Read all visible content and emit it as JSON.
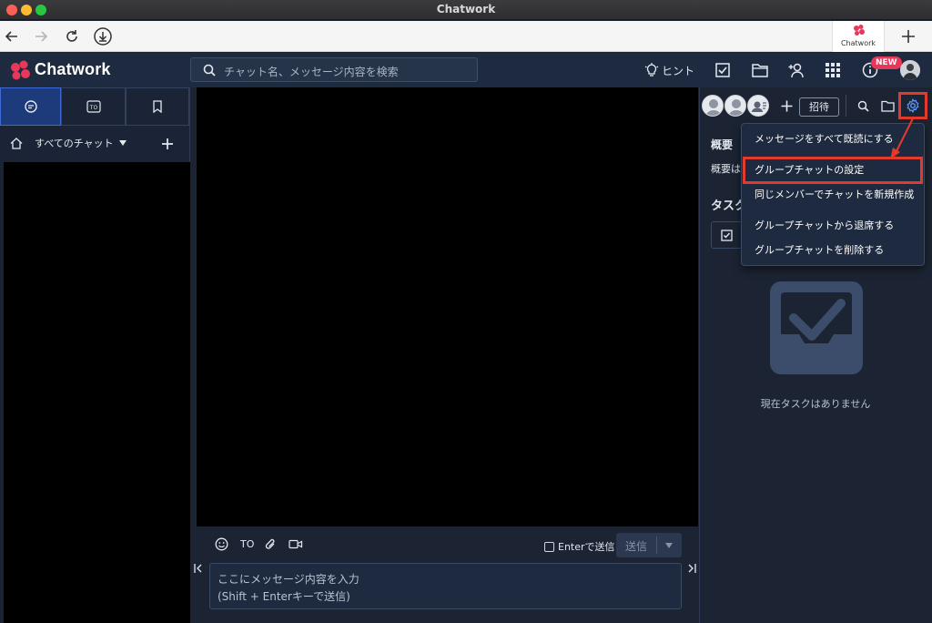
{
  "window": {
    "title": "Chatwork"
  },
  "browser": {
    "tab_label": "Chatwork"
  },
  "header": {
    "brand": "Chatwork",
    "search_placeholder": "チャット名、メッセージ内容を検索",
    "hint_label": "ヒント",
    "new_badge": "NEW"
  },
  "sidebar": {
    "filter_label": "すべてのチャット"
  },
  "composer": {
    "tool_to": "TO",
    "enter_send_label": "Enterで送信",
    "send_label": "送信",
    "placeholder_line1": "ここにメッセージ内容を入力",
    "placeholder_line2": "(Shift + Enterキーで送信)"
  },
  "room": {
    "invite_label": "招待",
    "overview_title": "概要",
    "overview_text": "概要は",
    "task_title": "タスク",
    "no_task_text": "現在タスクはありません"
  },
  "settings_menu": {
    "items": [
      "メッセージをすべて既読にする",
      "グループチャットの設定",
      "同じメンバーでチャットを新規作成",
      "グループチャットから退席する",
      "グループチャットを削除する"
    ],
    "highlighted_index": 1
  },
  "colors": {
    "header_bg": "#1e2a3f",
    "accent_red": "#e23b2e",
    "new_badge": "#e8385a",
    "logo_pink": "#e8385a"
  }
}
